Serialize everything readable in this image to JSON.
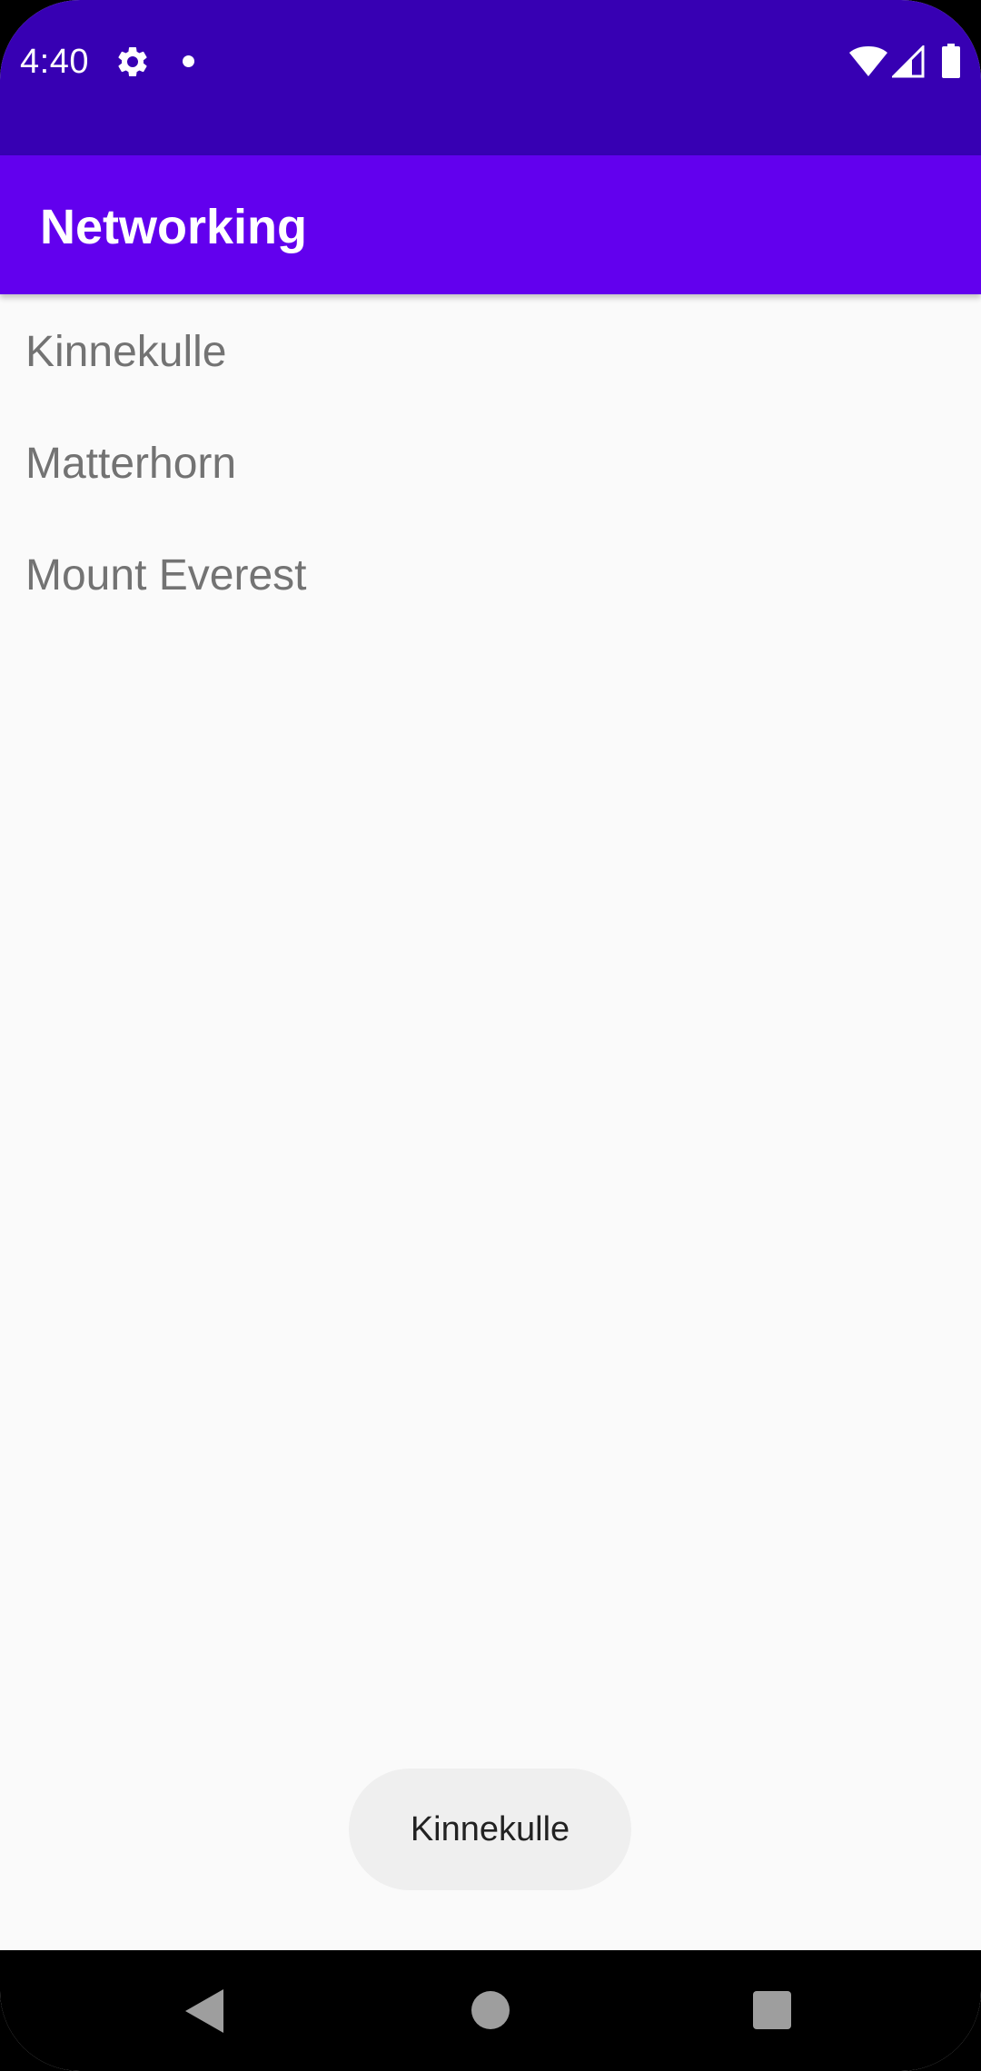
{
  "status_bar": {
    "time": "4:40",
    "icons": [
      "gear-icon",
      "notification-dot-icon",
      "wifi-icon",
      "cell-signal-icon",
      "battery-icon"
    ]
  },
  "app_bar": {
    "title": "Networking"
  },
  "list": {
    "items": [
      {
        "label": "Kinnekulle"
      },
      {
        "label": "Matterhorn"
      },
      {
        "label": "Mount Everest"
      }
    ]
  },
  "toast": {
    "message": "Kinnekulle"
  },
  "nav_bar": {
    "icons": [
      "back-icon",
      "home-icon",
      "recents-icon"
    ]
  },
  "colors": {
    "status_bar": "#3700b3",
    "app_bar": "#6200ee",
    "background": "#fafafa",
    "list_text": "#737373",
    "toast_background": "#efefef"
  }
}
